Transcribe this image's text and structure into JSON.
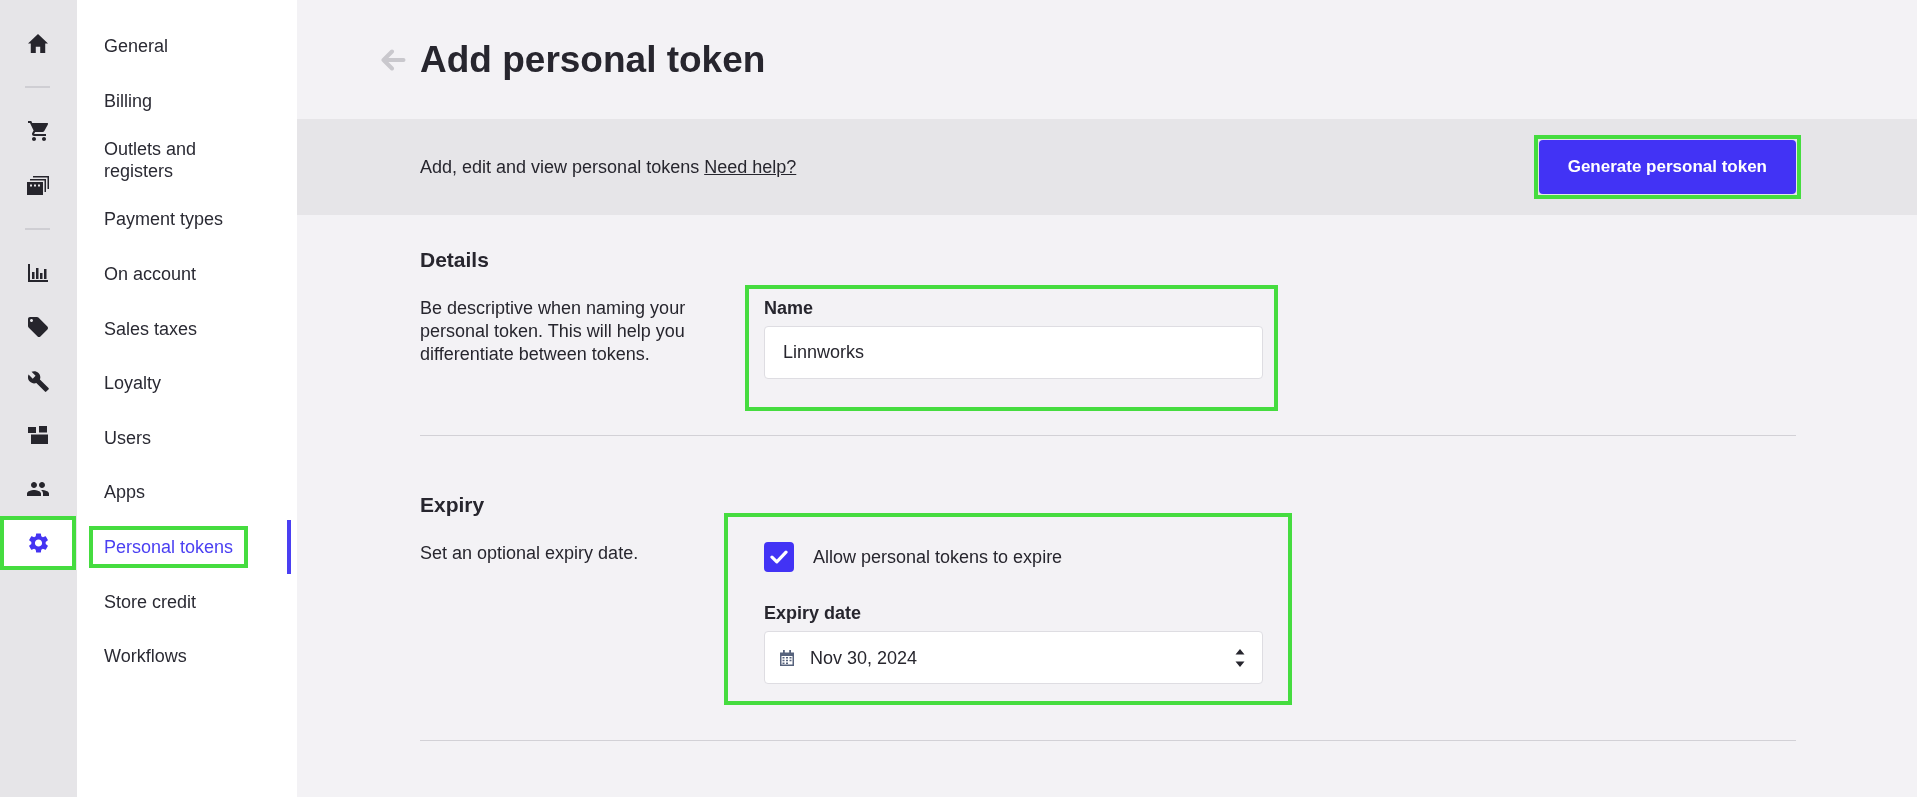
{
  "rail": {
    "groups": [
      {
        "items": [
          {
            "selected": false,
            "highlighted": false
          }
        ]
      },
      {
        "items": [
          {
            "selected": false,
            "highlighted": false
          },
          {
            "selected": false,
            "highlighted": false
          }
        ]
      },
      {
        "items": [
          {
            "selected": false,
            "highlighted": false
          },
          {
            "selected": false,
            "highlighted": false
          },
          {
            "selected": false,
            "highlighted": false
          },
          {
            "selected": false,
            "highlighted": false
          },
          {
            "selected": false,
            "highlighted": false
          },
          {
            "selected": true,
            "highlighted": true
          }
        ]
      }
    ]
  },
  "sidebar": {
    "items": [
      {
        "label": "General",
        "selected": false,
        "highlighted": false
      },
      {
        "label": "Billing",
        "selected": false,
        "highlighted": false
      },
      {
        "label": "Outlets and registers",
        "selected": false,
        "highlighted": false
      },
      {
        "label": "Payment types",
        "selected": false,
        "highlighted": false
      },
      {
        "label": "On account",
        "selected": false,
        "highlighted": false
      },
      {
        "label": "Sales taxes",
        "selected": false,
        "highlighted": false
      },
      {
        "label": "Loyalty",
        "selected": false,
        "highlighted": false
      },
      {
        "label": "Users",
        "selected": false,
        "highlighted": false
      },
      {
        "label": "Apps",
        "selected": false,
        "highlighted": false
      },
      {
        "label": "Personal tokens",
        "selected": true,
        "highlighted": true
      },
      {
        "label": "Store credit",
        "selected": false,
        "highlighted": false
      },
      {
        "label": "Workflows",
        "selected": false,
        "highlighted": false
      }
    ]
  },
  "header": {
    "title": "Add personal token"
  },
  "toolbar": {
    "description": "Add, edit and view personal tokens",
    "help_link": "Need help?",
    "button": {
      "label": "Generate personal token",
      "highlighted": true
    }
  },
  "details": {
    "heading": "Details",
    "description": "Be descriptive when naming your personal token. This will help you differentiate between tokens.",
    "highlighted": true,
    "field": {
      "label": "Name",
      "value": "Linnworks"
    }
  },
  "expiry": {
    "heading": "Expiry",
    "description": "Set an optional expiry date.",
    "highlighted": true,
    "checkbox": {
      "label": "Allow personal tokens to expire",
      "checked": true
    },
    "date_field": {
      "label": "Expiry date",
      "value": "Nov 30, 2024"
    }
  }
}
